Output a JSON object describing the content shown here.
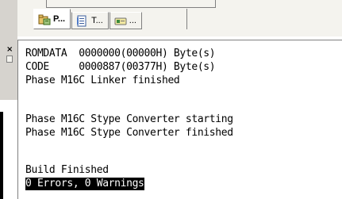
{
  "tabs": [
    {
      "label": "P...",
      "icon": "project-icon",
      "active": true
    },
    {
      "label": "T...",
      "icon": "templates-icon",
      "active": false
    },
    {
      "label": "...",
      "icon": "functions-icon",
      "active": false
    }
  ],
  "output": {
    "lines": [
      "ROMDATA  0000000(00000H) Byte(s)",
      "CODE     0000887(00377H) Byte(s)",
      "Phase M16C Linker finished",
      "",
      "Phase M16C Stype Converter starting",
      "Phase M16C Stype Converter finished",
      "",
      "Build Finished",
      "0 Errors, 0 Warnings"
    ],
    "selected_line_index": 8
  },
  "colors": {
    "panel_gray": "#d6d3ce",
    "selection_bg": "#000000",
    "selection_fg": "#ffffff"
  }
}
